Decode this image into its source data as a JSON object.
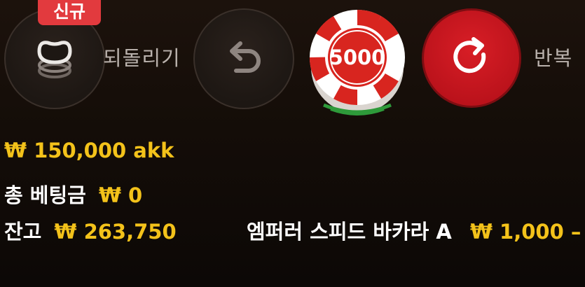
{
  "controls": {
    "new_badge": "신규",
    "undo_label": "되돌리기",
    "chip_value": "5000",
    "repeat_label": "반복"
  },
  "info": {
    "limit_text": "₩ 150,000 akk",
    "total_bet_label": "총 베팅금",
    "total_bet_value": "₩ 0",
    "balance_label": "잔고",
    "balance_value": "₩ 263,750",
    "table_name": "엠퍼러 스피드 바카라 A",
    "table_limit": "₩ 1,000 – "
  },
  "colors": {
    "accent_yellow": "#f3c21a",
    "chip_red": "#d8251f",
    "repeat_red": "#c8141c",
    "badge_red": "#e23a3e"
  }
}
